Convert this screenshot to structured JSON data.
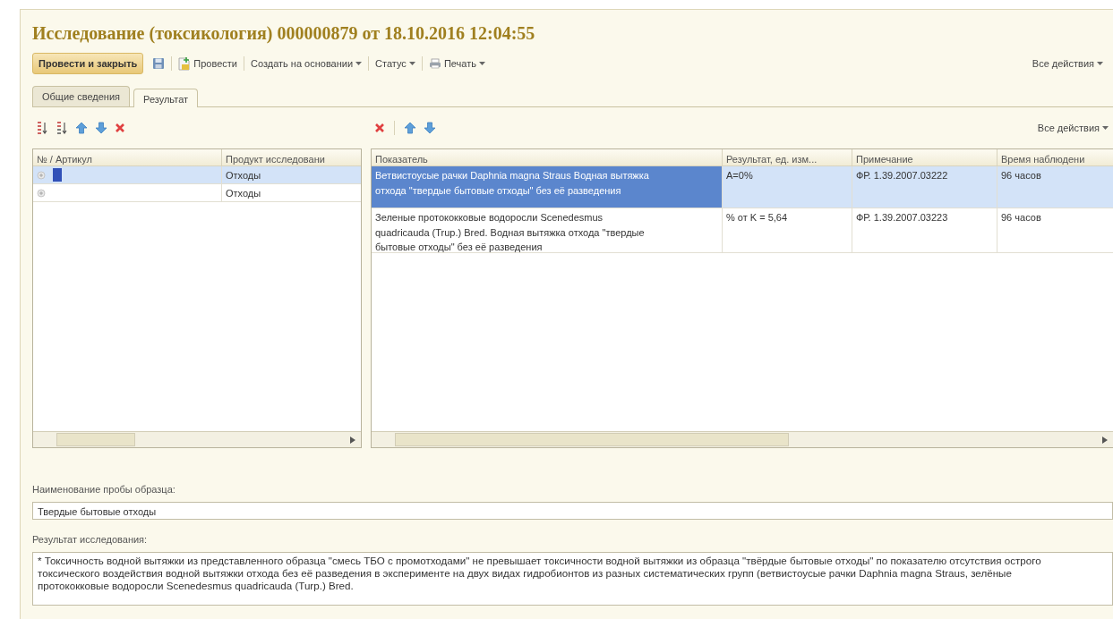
{
  "title": "Исследование (токсикология) 000000879 от 18.10.2016 12:04:55",
  "command_bar": {
    "items": [
      {
        "kind": "default",
        "label": "Провести и закрыть"
      },
      {
        "kind": "save"
      },
      {
        "kind": "post",
        "label": "Провести"
      },
      {
        "kind": "menu",
        "label": "Создать на основании"
      },
      {
        "kind": "menu",
        "label": "Статус"
      },
      {
        "kind": "print",
        "label": "Печать"
      }
    ],
    "all_actions": "Все действия"
  },
  "tabs": [
    {
      "label": "Общие сведения",
      "selected": false
    },
    {
      "label": "Результат",
      "selected": true
    }
  ],
  "products_table": {
    "columns": [
      "№ / Артикул",
      "Продукт исследовани"
    ],
    "rows": [
      {
        "product": "Отходы",
        "selected": true
      },
      {
        "product": "Отходы",
        "selected": false
      }
    ]
  },
  "indicators_table": {
    "all_actions": "Все действия",
    "columns": [
      "Показатель",
      "Результат, ед. изм...",
      "Примечание",
      "Время наблюдени"
    ],
    "rows": [
      {
        "cells": [
          "Ветвистоусые рачки Daphnia magna Straus Водная вытяжка отхода \"твердые бытовые отходы\" без её разведения",
          "А=0%",
          "ФР. 1.39.2007.03222",
          "96 часов"
        ],
        "selected": true
      },
      {
        "cells": [
          "Зеленые протококковые водоросли Scenedesmus quadricauda  (Trup.) Bred. Водная вытяжка отхода \"твердые бытовые отходы\" без её разведения",
          "% от K = 5,64",
          "ФР. 1.39.2007.03223",
          "96 часов"
        ],
        "selected": false
      }
    ]
  },
  "sample_name": {
    "label": "Наименование пробы образца:",
    "value": "Твердые бытовые отходы"
  },
  "study_result": {
    "label": "Результат исследования:",
    "value": "* Токсичность водной вытяжки из представленного образца \"смесь ТБО с промотходами\" не превышает токсичности водной вытяжки из образца \"твёрдые бытовые отходы\" по показателю отсутствия острого токсического воздействия водной вытяжки отхода без её разведения в эксперименте на двух видах гидробионтов из разных систематических групп (ветвистоусые рачки Daphnia magna Straus, зелёные протококковые водоросли Scenedesmus quadricauda (Turp.) Bred."
  }
}
